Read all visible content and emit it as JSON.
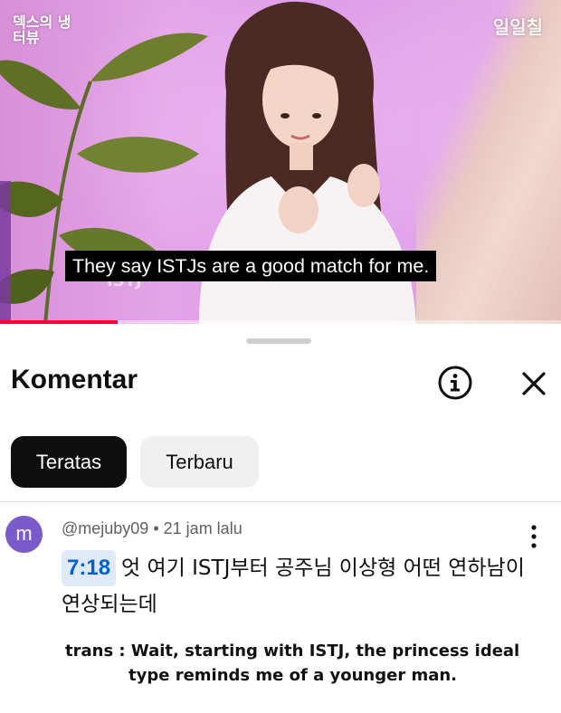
{
  "video": {
    "watermark_left": "덱스의 냉터뷰",
    "watermark_right": "일일칠",
    "subtitle": "They say ISTJs are a good match for me.",
    "progress": 0.21
  },
  "sheet": {
    "title": "Komentar",
    "info_icon": "info-icon",
    "close_icon": "close-icon",
    "chips": [
      "Teratas",
      "Terbaru"
    ]
  },
  "comment": {
    "avatar_letter": "m",
    "author": "@mejuby09",
    "time": "21 jam lalu",
    "timestamp": "7:18",
    "text": "엇 여기 ISTJ부터 공주님 이상형 어떤 연하남이 연상되는데",
    "translation_line1": "trans : Wait, starting with ISTJ, the princess ideal",
    "translation_line2": "type reminds me of a younger man."
  },
  "colors": {
    "accent_link": "#065fd4",
    "avatar": "#7b5bc9",
    "chip_active": "#0f0f0f",
    "progress": "#ff0033"
  }
}
